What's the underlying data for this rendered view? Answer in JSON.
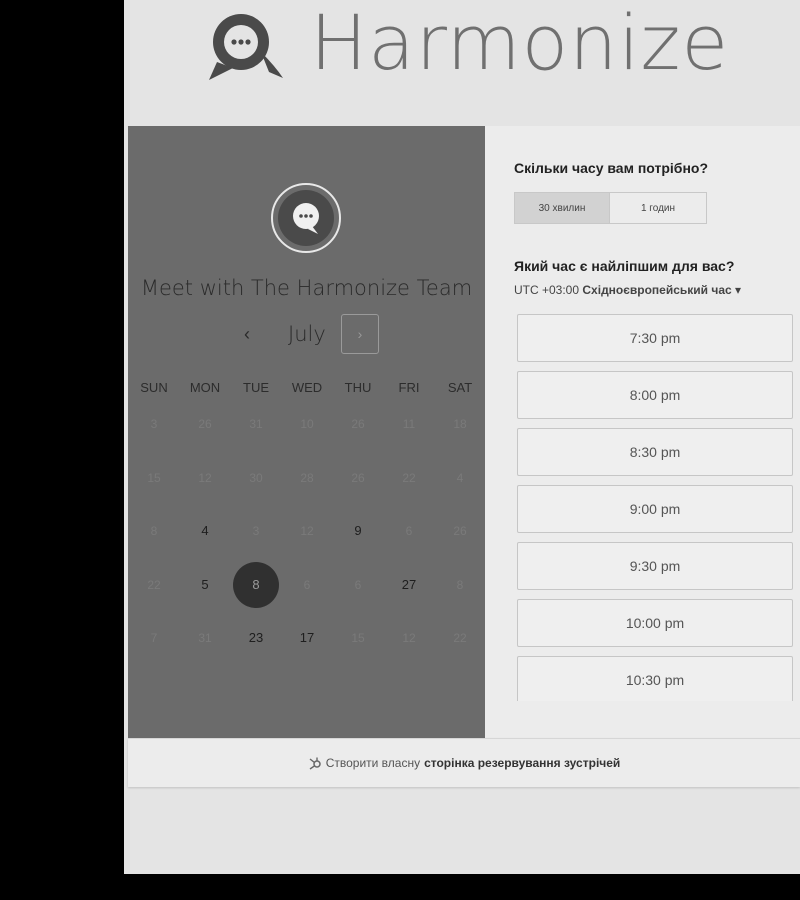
{
  "header": {
    "brand": "Harmonize"
  },
  "calendar": {
    "title": "Meet with The Harmonize Team",
    "prev_icon": "‹",
    "month": "July",
    "next_icon": "›",
    "weekdays": [
      "SUN",
      "MON",
      "TUE",
      "WED",
      "THU",
      "FRI",
      "SAT"
    ],
    "weeks": [
      [
        "3",
        "26",
        "31",
        "10",
        "26",
        "11",
        "18"
      ],
      [
        "15",
        "12",
        "30",
        "28",
        "26",
        "22",
        "4"
      ],
      [
        "8",
        "4",
        "3",
        "12",
        "9",
        "6",
        "26"
      ],
      [
        "22",
        "5",
        "8",
        "6",
        "6",
        "27",
        "8"
      ],
      [
        "7",
        "31",
        "23",
        "17",
        "15",
        "12",
        "22"
      ]
    ],
    "available": [
      [
        2,
        1
      ],
      [
        2,
        4
      ],
      [
        3,
        1
      ],
      [
        3,
        2
      ],
      [
        3,
        5
      ],
      [
        4,
        2
      ],
      [
        4,
        3
      ]
    ],
    "selected": [
      3,
      2
    ]
  },
  "scheduler": {
    "duration_question": "Скільки часу вам потрібно?",
    "durations": [
      "30 хвилин",
      "1 годин"
    ],
    "active_duration": 0,
    "time_question": "Який час є найліпшим для вас?",
    "timezone_offset": "UTC +03:00",
    "timezone_name": "Східноєвропейський час",
    "slots": [
      "7:30 pm",
      "8:00 pm",
      "8:30 pm",
      "9:00 pm",
      "9:30 pm",
      "10:00 pm",
      "10:30 pm"
    ]
  },
  "footer": {
    "prefix": "Створити власну",
    "link": "сторінка резервування зустрічей"
  },
  "colors": {
    "panel": "#6b6b6b",
    "selected_day": "#303030",
    "background": "#e4e4e4"
  }
}
